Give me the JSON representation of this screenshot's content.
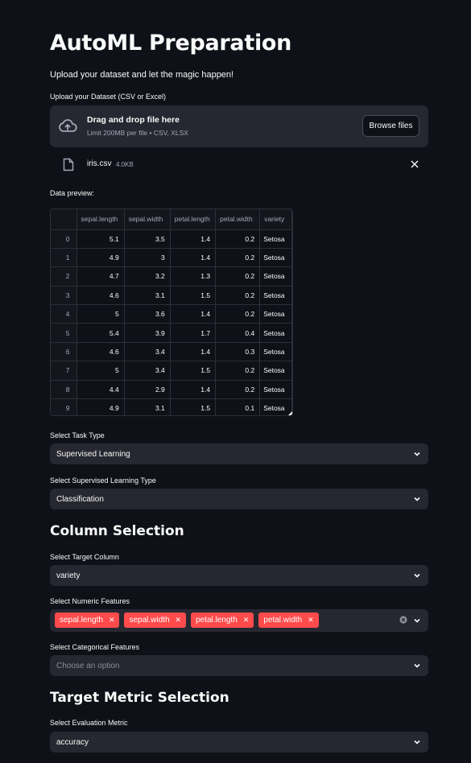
{
  "page": {
    "title": "AutoML Preparation",
    "subtitle": "Upload your dataset and let the magic happen!"
  },
  "upload": {
    "label": "Upload your Dataset (CSV or Excel)",
    "drop_text": "Drag and drop file here",
    "limit_text": "Limit 200MB per file • CSV, XLSX",
    "browse_label": "Browse files",
    "file_name": "iris.csv",
    "file_size": "4.0KB"
  },
  "preview": {
    "label": "Data preview:",
    "columns": [
      "sepal.length",
      "sepal.width",
      "petal.length",
      "petal.width",
      "variety"
    ],
    "rows": [
      [
        "0",
        "5.1",
        "3.5",
        "1.4",
        "0.2",
        "Setosa"
      ],
      [
        "1",
        "4.9",
        "3",
        "1.4",
        "0.2",
        "Setosa"
      ],
      [
        "2",
        "4.7",
        "3.2",
        "1.3",
        "0.2",
        "Setosa"
      ],
      [
        "3",
        "4.6",
        "3.1",
        "1.5",
        "0.2",
        "Setosa"
      ],
      [
        "4",
        "5",
        "3.6",
        "1.4",
        "0.2",
        "Setosa"
      ],
      [
        "5",
        "5.4",
        "3.9",
        "1.7",
        "0.4",
        "Setosa"
      ],
      [
        "6",
        "4.6",
        "3.4",
        "1.4",
        "0.3",
        "Setosa"
      ],
      [
        "7",
        "5",
        "3.4",
        "1.5",
        "0.2",
        "Setosa"
      ],
      [
        "8",
        "4.4",
        "2.9",
        "1.4",
        "0.2",
        "Setosa"
      ],
      [
        "9",
        "4.9",
        "3.1",
        "1.5",
        "0.1",
        "Setosa"
      ]
    ]
  },
  "task": {
    "label": "Select Task Type",
    "value": "Supervised Learning"
  },
  "supervised": {
    "label": "Select Supervised Learning Type",
    "value": "Classification"
  },
  "column_selection": {
    "heading": "Column Selection",
    "target_label": "Select Target Column",
    "target_value": "variety",
    "numeric_label": "Select Numeric Features",
    "numeric_tags": [
      "sepal.length",
      "sepal.width",
      "petal.length",
      "petal.width"
    ],
    "categorical_label": "Select Categorical Features",
    "categorical_placeholder": "Choose an option"
  },
  "metric": {
    "heading": "Target Metric Selection",
    "label": "Select Evaluation Metric",
    "value": "accuracy"
  },
  "colors": {
    "background": "#0e1117",
    "widget": "#262730",
    "accent": "#ff4b4b"
  }
}
